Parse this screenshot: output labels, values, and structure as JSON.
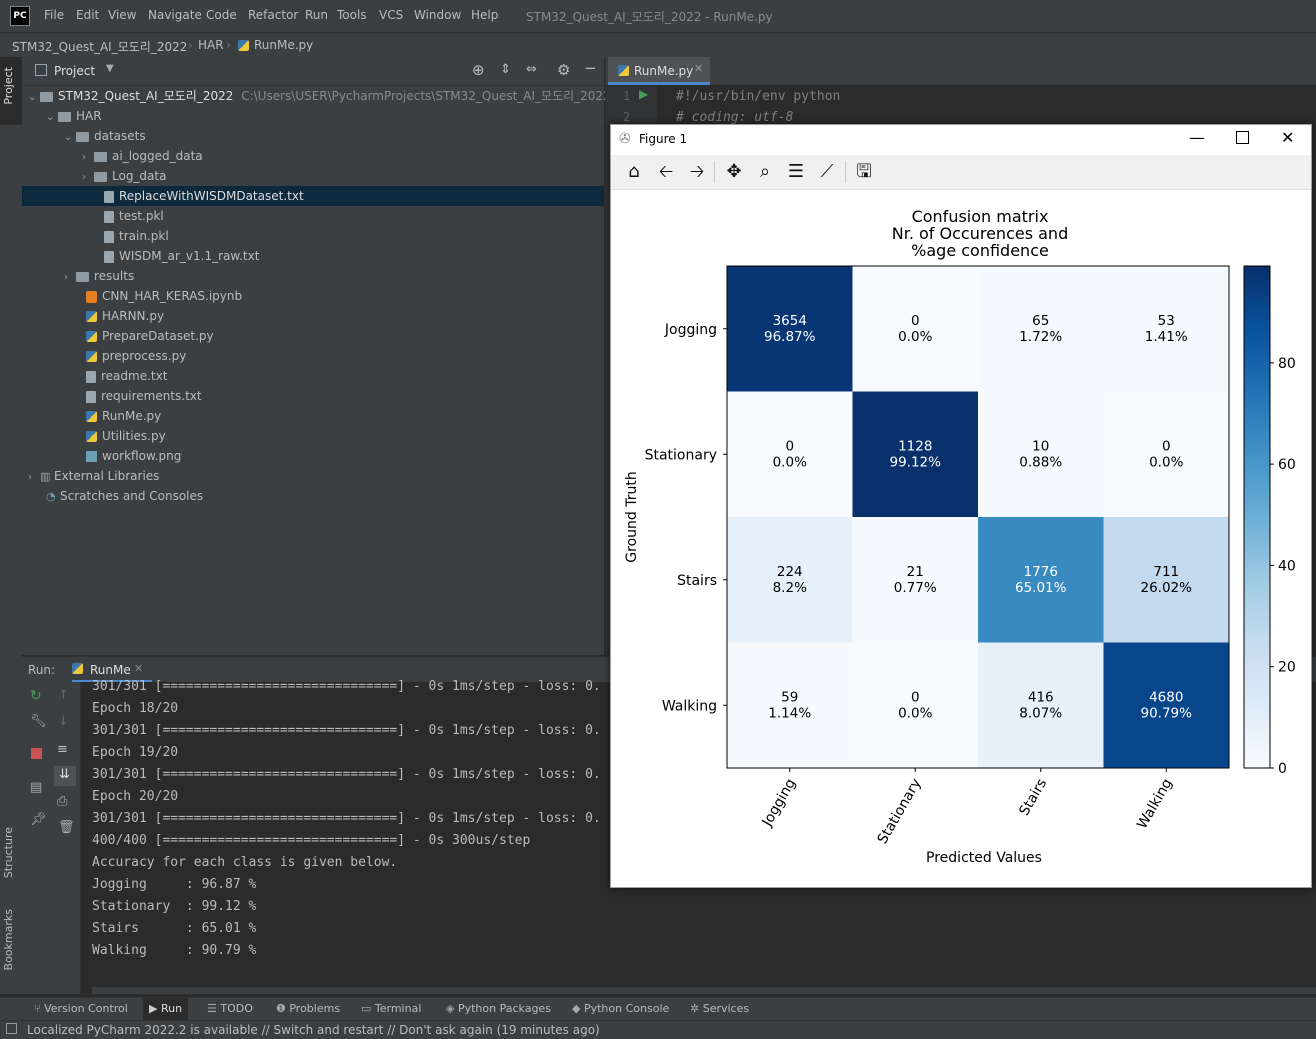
{
  "menu": {
    "logo": "PC",
    "items": [
      "File",
      "Edit",
      "View",
      "Navigate",
      "Code",
      "Refactor",
      "Run",
      "Tools",
      "VCS",
      "Window",
      "Help"
    ],
    "window_title": "STM32_Quest_AI_모도리_2022 - RunMe.py"
  },
  "breadcrumb": [
    "STM32_Quest_AI_모도리_2022",
    "HAR",
    "RunMe.py"
  ],
  "side_tabs": {
    "project": "Project",
    "structure": "Structure",
    "bookmarks": "Bookmarks"
  },
  "project_panel": {
    "title": "Project",
    "root_name": "STM32_Quest_AI_모도리_2022",
    "root_path": "C:\\Users\\USER\\PycharmProjects\\STM32_Quest_AI_모도리_2022",
    "tree": [
      {
        "label": "HAR"
      },
      {
        "label": "datasets"
      },
      {
        "label": "ai_logged_data"
      },
      {
        "label": "Log_data"
      },
      {
        "label": "ReplaceWithWISDMDataset.txt"
      },
      {
        "label": "test.pkl"
      },
      {
        "label": "train.pkl"
      },
      {
        "label": "WISDM_ar_v1.1_raw.txt"
      },
      {
        "label": "results"
      },
      {
        "label": "CNN_HAR_KERAS.ipynb"
      },
      {
        "label": "HARNN.py"
      },
      {
        "label": "PrepareDataset.py"
      },
      {
        "label": "preprocess.py"
      },
      {
        "label": "readme.txt"
      },
      {
        "label": "requirements.txt"
      },
      {
        "label": "RunMe.py"
      },
      {
        "label": "Utilities.py"
      },
      {
        "label": "workflow.png"
      },
      {
        "label": "External Libraries"
      },
      {
        "label": "Scratches and Consoles"
      }
    ]
  },
  "editor": {
    "tab": "RunMe.py",
    "lines": [
      {
        "num": "1",
        "code": "#!/usr/bin/env python"
      },
      {
        "num": "2",
        "code": "# coding: utf-8"
      }
    ]
  },
  "run_panel": {
    "label": "Run:",
    "config": "RunMe",
    "console": [
      "301/301 [==============================] - 0s 1ms/step - loss: 0.",
      "Epoch 18/20",
      "301/301 [==============================] - 0s 1ms/step - loss: 0.",
      "Epoch 19/20",
      "301/301 [==============================] - 0s 1ms/step - loss: 0.",
      "Epoch 20/20",
      "301/301 [==============================] - 0s 1ms/step - loss: 0.",
      "400/400 [==============================] - 0s 300us/step",
      "Accuracy for each class is given below.",
      "Jogging     : 96.87 %",
      "Stationary  : 99.12 %",
      "Stairs      : 65.01 %",
      "Walking     : 90.79 %"
    ]
  },
  "tool_windows": [
    "Version Control",
    "Run",
    "TODO",
    "Problems",
    "Terminal",
    "Python Packages",
    "Python Console",
    "Services"
  ],
  "status_message": "Localized PyCharm 2022.2 is available // Switch and restart // Don't ask again (19 minutes ago)",
  "figure": {
    "window_title": "Figure 1",
    "toolbar_icons": [
      "home-icon",
      "back-icon",
      "forward-icon",
      "pan-icon",
      "zoom-icon",
      "configure-subplots-icon",
      "edit-axis-icon",
      "save-icon"
    ]
  },
  "chart_data": {
    "type": "heatmap",
    "title": [
      "Confusion matrix",
      "Nr. of Occurences and",
      "%age confidence"
    ],
    "xlabel": "Predicted Values",
    "ylabel": "Ground Truth",
    "x_categories": [
      "Jogging",
      "Stationary",
      "Stairs",
      "Walking"
    ],
    "y_categories": [
      "Jogging",
      "Stationary",
      "Stairs",
      "Walking"
    ],
    "counts": [
      [
        3654,
        0,
        65,
        53
      ],
      [
        0,
        1128,
        10,
        0
      ],
      [
        224,
        21,
        1776,
        711
      ],
      [
        59,
        0,
        416,
        4680
      ]
    ],
    "percents": [
      [
        "96.87%",
        "0.0%",
        "1.72%",
        "1.41%"
      ],
      [
        "0.0%",
        "99.12%",
        "0.88%",
        "0.0%"
      ],
      [
        "8.2%",
        "0.77%",
        "65.01%",
        "26.02%"
      ],
      [
        "1.14%",
        "0.0%",
        "8.07%",
        "90.79%"
      ]
    ],
    "values": [
      [
        96.87,
        0.0,
        1.72,
        1.41
      ],
      [
        0.0,
        99.12,
        0.88,
        0.0
      ],
      [
        8.2,
        0.77,
        65.01,
        26.02
      ],
      [
        1.14,
        0.0,
        8.07,
        90.79
      ]
    ],
    "colorbar_ticks": [
      0,
      20,
      40,
      60,
      80
    ],
    "colorbar_range": [
      0,
      99.12
    ],
    "colormap": "Blues",
    "colormap_endpoints": [
      "#f7fbff",
      "#08306b"
    ],
    "grid": false
  }
}
